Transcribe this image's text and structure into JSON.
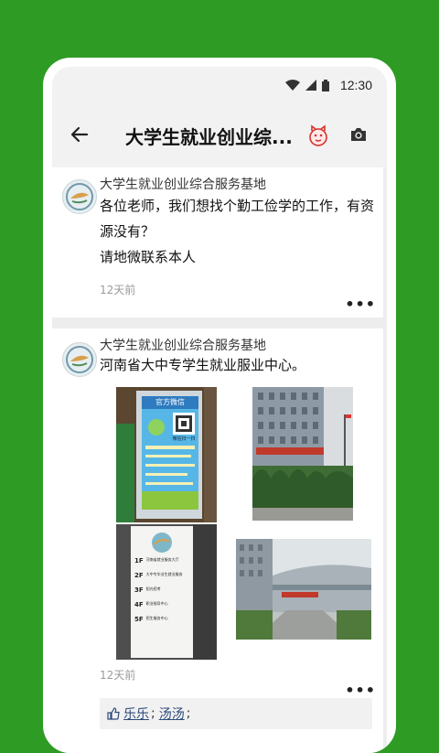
{
  "status_bar": {
    "time": "12:30"
  },
  "app_bar": {
    "title": "大学生就业创业综..."
  },
  "posts": [
    {
      "author": "大学生就业创业综合服务基地",
      "text_line1": "各位老师，我们想找个勤工俭学的工作，有资",
      "text_line2": "源没有？",
      "text_line3": "请地微联系本人",
      "time": "12天前",
      "more": "•••"
    },
    {
      "author": "大学生就业创业综合服务基地",
      "text": "河南省大中专学生就业服业中心。",
      "time": "12天前",
      "more": "•••",
      "poster_header": "官方微信",
      "poster_qr_caption": "微信扫一扫",
      "directory": {
        "floors": [
          "1F",
          "2F",
          "3F",
          "4F",
          "5F"
        ],
        "lines": [
          "河南省就业服务大厅",
          "大中专毕业生就业服务",
          "阳光招考",
          "职业指导中心",
          "招生服务中心"
        ]
      },
      "likes": {
        "user1": "乐乐",
        "sep1": ";",
        "user2": "汤汤",
        "sep2": ";"
      }
    }
  ],
  "colors": {
    "background": "#2e9b25",
    "card": "#ffffff",
    "feed_bg": "#ededed",
    "link": "#2c4a7a"
  }
}
